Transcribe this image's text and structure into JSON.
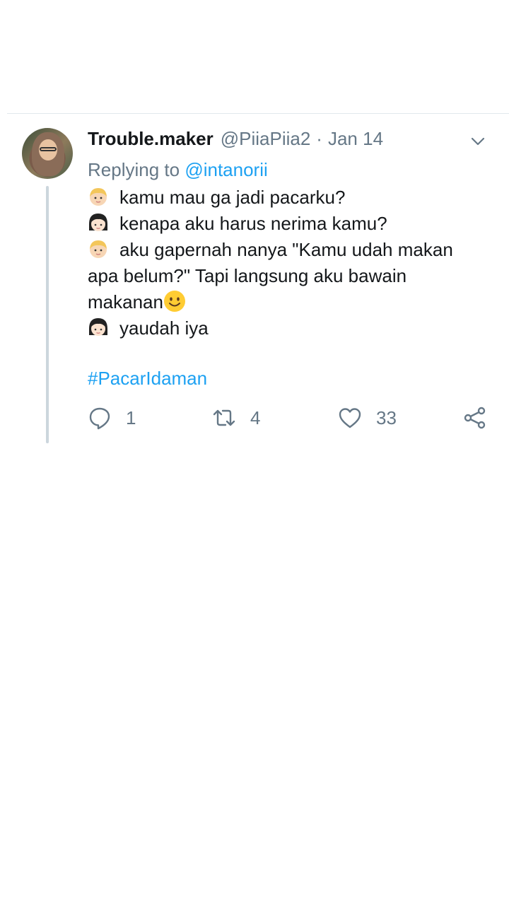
{
  "tweet": {
    "display_name": "Trouble.maker",
    "handle": "@PiiaPiia2",
    "separator": "·",
    "date": "Jan 14",
    "reply_prefix": "Replying to",
    "reply_to": "@intanorii",
    "lines": [
      {
        "speaker": "boy-emoji",
        "text": "kamu mau ga jadi pacarku?"
      },
      {
        "speaker": "girl-emoji",
        "text": "kenapa aku harus nerima kamu?"
      },
      {
        "speaker": "boy-emoji",
        "text": "aku gapernah nanya \"Kamu udah makan"
      },
      {
        "speaker": "",
        "text": "apa belum?\" Tapi langsung aku bawain"
      },
      {
        "speaker": "",
        "text": "makanan",
        "trailing_emoji": "smiling-face-emoji"
      },
      {
        "speaker": "girl-emoji",
        "text": "yaudah iya"
      }
    ],
    "hashtag": "#PacarIdaman",
    "actions": {
      "reply_count": "1",
      "retweet_count": "4",
      "like_count": "33"
    },
    "icons": {
      "reply": "reply-icon",
      "retweet": "retweet-icon",
      "like": "heart-icon",
      "share": "share-icon",
      "menu": "chevron-down-icon"
    },
    "colors": {
      "link": "#1da1f2",
      "secondary_text": "#657786",
      "primary_text": "#14171a",
      "thread_line": "#ccd6dd"
    }
  }
}
